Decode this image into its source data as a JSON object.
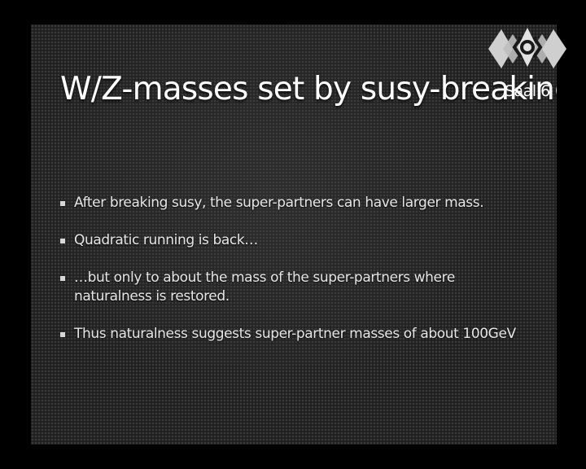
{
  "slide": {
    "title": "W/Z-masses set by susy-breaking",
    "bullets": [
      "After breaking susy, the super-partners can have larger mass.",
      "Quadratic running is back…",
      "…but only to about the mass of the super-partners where naturalness is restored.",
      "Thus naturalness suggests super-partner masses of about 100GeV"
    ]
  },
  "overlay": {
    "room_label": "Saal 6",
    "logo_icon": "conference-logo-icon"
  },
  "colors": {
    "background": "#000000",
    "slide_background": "#262626",
    "text": "#ffffff",
    "logo": "#d0d0d0"
  }
}
